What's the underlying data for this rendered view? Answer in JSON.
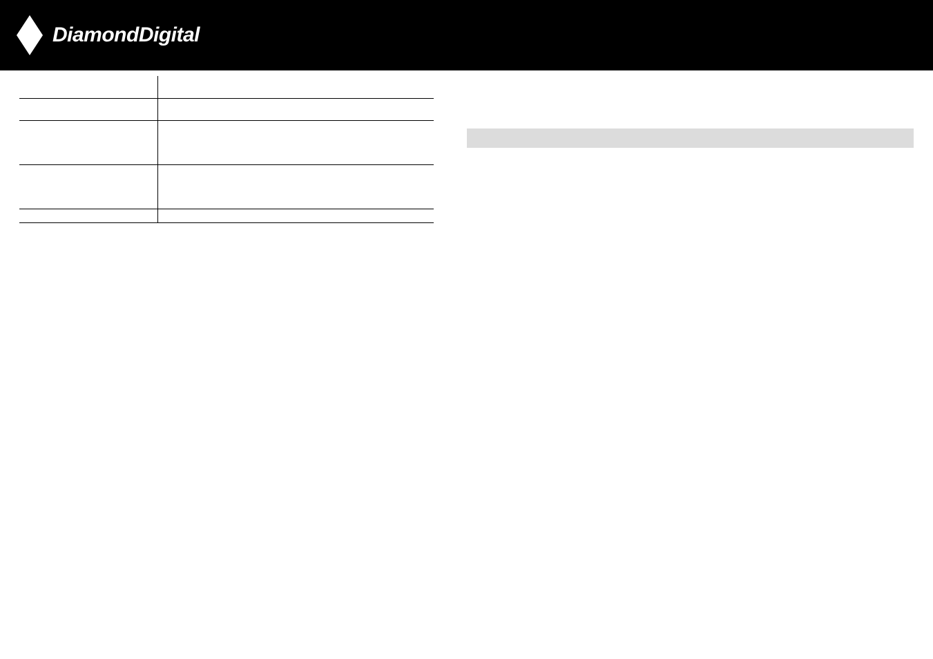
{
  "header": {
    "brand": "DiamondDigital"
  }
}
